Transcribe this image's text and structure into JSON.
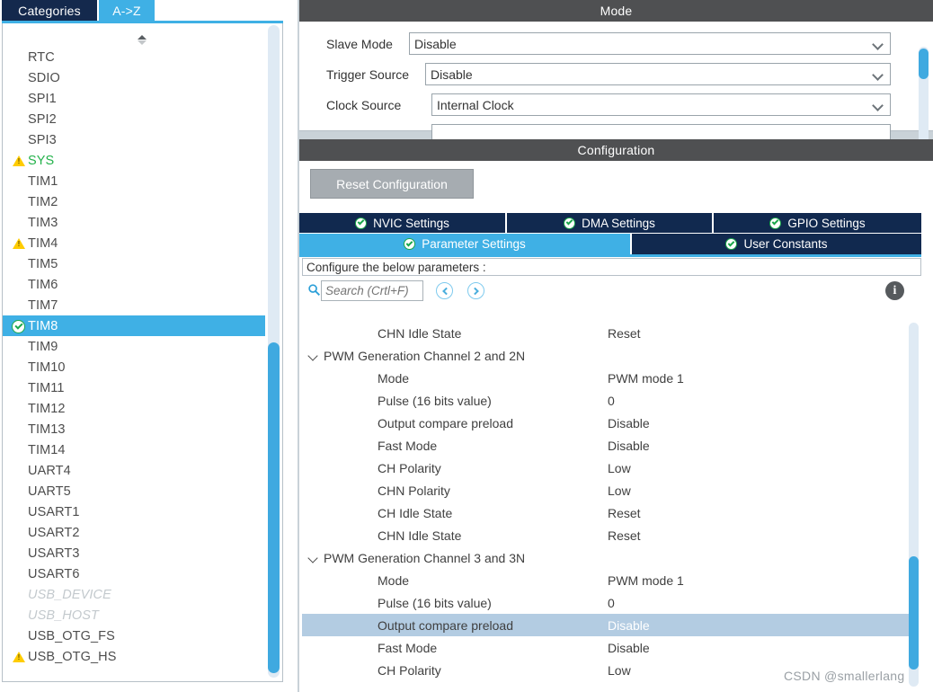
{
  "colors": {
    "accent_blue": "#3fb0e5",
    "tab_navy": "#11294f",
    "header_gray": "#4f5052",
    "check_green": "#1aa84a",
    "warn_yellow": "#ffcc00",
    "row_highlight": "#b3cce2",
    "disabled_gray": "#a6acb1"
  },
  "left_panel": {
    "tabs": [
      {
        "label": "Categories",
        "active": false
      },
      {
        "label": "A->Z",
        "active": true
      }
    ],
    "spinner_icon": "spinner-up-down-icon",
    "peripherals": [
      {
        "name": "RTC",
        "state": "normal",
        "icon": "none"
      },
      {
        "name": "SDIO",
        "state": "normal",
        "icon": "none"
      },
      {
        "name": "SPI1",
        "state": "normal",
        "icon": "none"
      },
      {
        "name": "SPI2",
        "state": "normal",
        "icon": "none"
      },
      {
        "name": "SPI3",
        "state": "normal",
        "icon": "none"
      },
      {
        "name": "SYS",
        "state": "green",
        "icon": "warning-triangle-icon"
      },
      {
        "name": "TIM1",
        "state": "normal",
        "icon": "none"
      },
      {
        "name": "TIM2",
        "state": "normal",
        "icon": "none"
      },
      {
        "name": "TIM3",
        "state": "normal",
        "icon": "none"
      },
      {
        "name": "TIM4",
        "state": "normal",
        "icon": "warning-triangle-icon"
      },
      {
        "name": "TIM5",
        "state": "normal",
        "icon": "none"
      },
      {
        "name": "TIM6",
        "state": "normal",
        "icon": "none"
      },
      {
        "name": "TIM7",
        "state": "normal",
        "icon": "none"
      },
      {
        "name": "TIM8",
        "state": "selected",
        "icon": "green-check-icon"
      },
      {
        "name": "TIM9",
        "state": "normal",
        "icon": "none"
      },
      {
        "name": "TIM10",
        "state": "normal",
        "icon": "none"
      },
      {
        "name": "TIM11",
        "state": "normal",
        "icon": "none"
      },
      {
        "name": "TIM12",
        "state": "normal",
        "icon": "none"
      },
      {
        "name": "TIM13",
        "state": "normal",
        "icon": "none"
      },
      {
        "name": "TIM14",
        "state": "normal",
        "icon": "none"
      },
      {
        "name": "UART4",
        "state": "normal",
        "icon": "none"
      },
      {
        "name": "UART5",
        "state": "normal",
        "icon": "none"
      },
      {
        "name": "USART1",
        "state": "normal",
        "icon": "none"
      },
      {
        "name": "USART2",
        "state": "normal",
        "icon": "none"
      },
      {
        "name": "USART3",
        "state": "normal",
        "icon": "none"
      },
      {
        "name": "USART6",
        "state": "normal",
        "icon": "none"
      },
      {
        "name": "USB_DEVICE",
        "state": "disabled",
        "icon": "none"
      },
      {
        "name": "USB_HOST",
        "state": "disabled",
        "icon": "none"
      },
      {
        "name": "USB_OTG_FS",
        "state": "normal",
        "icon": "none"
      },
      {
        "name": "USB_OTG_HS",
        "state": "normal",
        "icon": "warning-triangle-icon"
      }
    ]
  },
  "mode_panel": {
    "title": "Mode",
    "rows": [
      {
        "label": "Slave Mode",
        "value": "Disable"
      },
      {
        "label": "Trigger Source",
        "value": "Disable"
      },
      {
        "label": "Clock Source",
        "value": "Internal Clock"
      },
      {
        "label": "",
        "value": ""
      }
    ]
  },
  "configuration_panel": {
    "title": "Configuration",
    "reset_button": "Reset Configuration",
    "tabs_row1": [
      {
        "label": "NVIC Settings",
        "active": false,
        "icon": "green-check-icon"
      },
      {
        "label": "DMA Settings",
        "active": false,
        "icon": "green-check-icon"
      },
      {
        "label": "GPIO Settings",
        "active": false,
        "icon": "green-check-icon"
      }
    ],
    "tabs_row2": [
      {
        "label": "Parameter Settings",
        "active": true,
        "icon": "green-check-icon"
      },
      {
        "label": "User Constants",
        "active": false,
        "icon": "green-check-icon"
      }
    ],
    "configure_hint": "Configure the below parameters :",
    "search": {
      "placeholder": "Search (Crtl+F)",
      "value": "",
      "icon": "search-icon",
      "prev_icon": "chevron-left-circle-icon",
      "next_icon": "chevron-right-circle-icon",
      "info_icon": "info-icon"
    },
    "parameters": [
      {
        "type": "item",
        "label": "CHN Idle State",
        "value": "Reset",
        "highlight": false
      },
      {
        "type": "group",
        "label": "PWM Generation Channel 2 and 2N",
        "value": "",
        "highlight": false
      },
      {
        "type": "item",
        "label": "Mode",
        "value": "PWM mode 1",
        "highlight": false
      },
      {
        "type": "item",
        "label": "Pulse (16 bits value)",
        "value": "0",
        "highlight": false
      },
      {
        "type": "item",
        "label": "Output compare preload",
        "value": "Disable",
        "highlight": false
      },
      {
        "type": "item",
        "label": "Fast Mode",
        "value": "Disable",
        "highlight": false
      },
      {
        "type": "item",
        "label": "CH Polarity",
        "value": "Low",
        "highlight": false
      },
      {
        "type": "item",
        "label": "CHN Polarity",
        "value": "Low",
        "highlight": false
      },
      {
        "type": "item",
        "label": "CH Idle State",
        "value": "Reset",
        "highlight": false
      },
      {
        "type": "item",
        "label": "CHN Idle State",
        "value": "Reset",
        "highlight": false
      },
      {
        "type": "group",
        "label": "PWM Generation Channel 3 and 3N",
        "value": "",
        "highlight": false
      },
      {
        "type": "item",
        "label": "Mode",
        "value": "PWM mode 1",
        "highlight": false
      },
      {
        "type": "item",
        "label": "Pulse (16 bits value)",
        "value": "0",
        "highlight": false
      },
      {
        "type": "item",
        "label": "Output compare preload",
        "value": "Disable",
        "highlight": true
      },
      {
        "type": "item",
        "label": "Fast Mode",
        "value": "Disable",
        "highlight": false
      },
      {
        "type": "item",
        "label": "CH Polarity",
        "value": "Low",
        "highlight": false
      }
    ]
  },
  "watermark": "CSDN @smallerlang"
}
